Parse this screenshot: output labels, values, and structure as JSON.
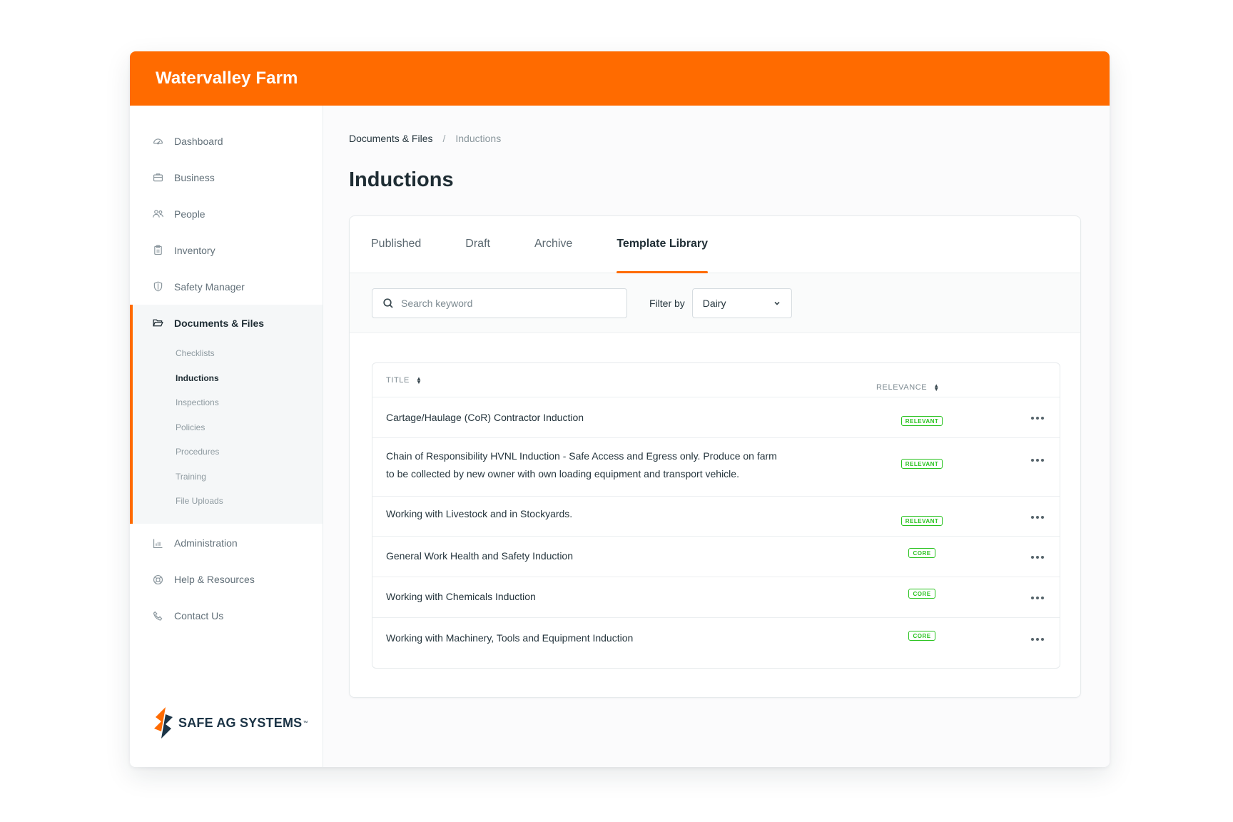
{
  "header": {
    "farm_name": "Watervalley Farm"
  },
  "sidebar": {
    "items": [
      {
        "label": "Dashboard",
        "icon": "speedometer-icon"
      },
      {
        "label": "Business",
        "icon": "briefcase-icon"
      },
      {
        "label": "People",
        "icon": "people-icon"
      },
      {
        "label": "Inventory",
        "icon": "clipboard-icon"
      },
      {
        "label": "Safety Manager",
        "icon": "shield-icon"
      }
    ],
    "active_group": {
      "label": "Documents & Files",
      "icon": "folder-open-icon",
      "sub_items": [
        {
          "label": "Checklists",
          "active": false
        },
        {
          "label": "Inductions",
          "active": true
        },
        {
          "label": "Inspections",
          "active": false
        },
        {
          "label": "Policies",
          "active": false
        },
        {
          "label": "Procedures",
          "active": false
        },
        {
          "label": "Training",
          "active": false
        },
        {
          "label": "File Uploads",
          "active": false
        }
      ]
    },
    "bottom_items": [
      {
        "label": "Administration",
        "icon": "bar-chart-icon"
      },
      {
        "label": "Help & Resources",
        "icon": "lifebuoy-icon"
      },
      {
        "label": "Contact Us",
        "icon": "phone-icon"
      }
    ],
    "brand": {
      "name": "SAFE AG SYSTEMS",
      "tm": "™"
    }
  },
  "breadcrumb": {
    "parent": "Documents & Files",
    "separator": "/",
    "current": "Inductions"
  },
  "page_title": "Inductions",
  "tabs": [
    {
      "label": "Published",
      "active": false
    },
    {
      "label": "Draft",
      "active": false
    },
    {
      "label": "Archive",
      "active": false
    },
    {
      "label": "Template Library",
      "active": true
    }
  ],
  "toolbar": {
    "search_placeholder": "Search keyword",
    "filter_label": "Filter by",
    "filter_value": "Dairy"
  },
  "table": {
    "columns": {
      "title": "TITLE",
      "relevance": "RELEVANCE"
    },
    "rows": [
      {
        "title": "Cartage/Haulage (CoR) Contractor Induction",
        "badge": "RELEVANT"
      },
      {
        "title": "Chain of Responsibility HVNL Induction - Safe Access and Egress only. Produce on farm to be collected by new owner with own loading equipment and transport vehicle.",
        "badge": "RELEVANT"
      },
      {
        "title": "Working with Livestock and in Stockyards.",
        "badge": "RELEVANT"
      },
      {
        "title": "General Work Health and Safety Induction",
        "badge": "CORE"
      },
      {
        "title": "Working with Chemicals Induction",
        "badge": "CORE"
      },
      {
        "title": "Working with Machinery, Tools and Equipment Induction",
        "badge": "CORE"
      }
    ]
  },
  "colors": {
    "accent": "#ff6b00",
    "badge_green": "#27c21d",
    "text_dark": "#1f2d34"
  }
}
